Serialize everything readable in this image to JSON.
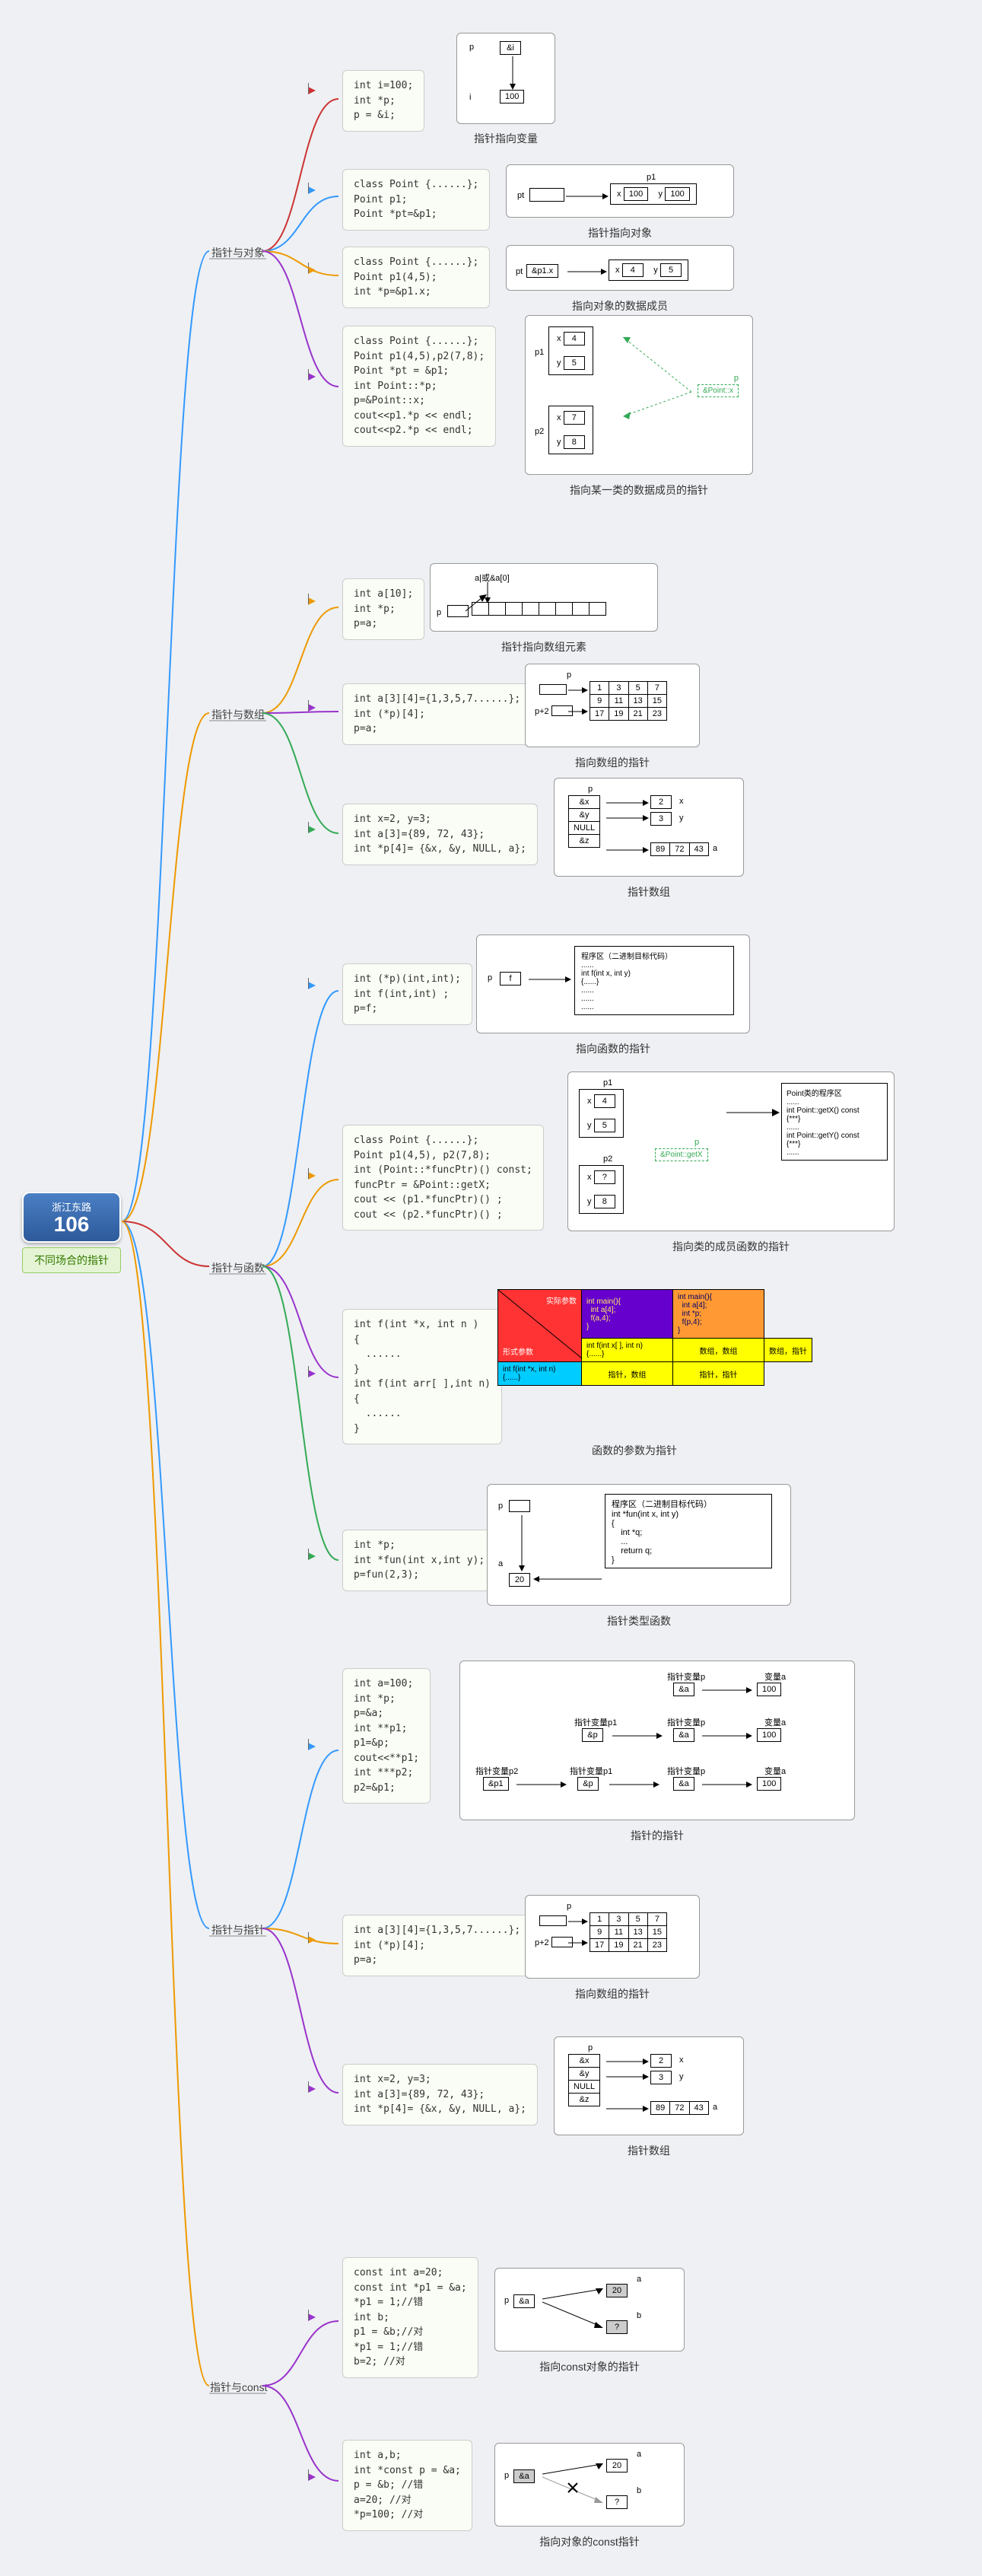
{
  "root": {
    "road": "浙江东路",
    "number": "106",
    "label": "不同场合的指针"
  },
  "branches": [
    {
      "id": "b1",
      "label": "指针与对象"
    },
    {
      "id": "b2",
      "label": "指针与数组"
    },
    {
      "id": "b3",
      "label": "指针与函数"
    },
    {
      "id": "b4",
      "label": "指针与指针"
    },
    {
      "id": "b5",
      "label": "指针与const"
    }
  ],
  "b1": {
    "n1": {
      "code": "int i=100;\nint *p;\np = &i;",
      "caption": "指针指向变量",
      "val_p": "&i",
      "val_i": "100",
      "lp": "p",
      "li": "i"
    },
    "n2": {
      "code": "class Point {......};\nPoint p1;\nPoint *pt=&p1;",
      "caption": "指针指向对象",
      "lbl_pt": "pt",
      "lbl_p1": "p1",
      "lbl_x": "x",
      "lbl_y": "y",
      "val_x": "100",
      "val_y": "100"
    },
    "n3": {
      "code": "class Point {......};\nPoint p1(4,5);\nint *p=&p1.x;",
      "caption": "指向对象的数据成员",
      "lbl_pt": "pt",
      "lbl_addr": "&p1.x",
      "lbl_x": "x",
      "lbl_y": "y",
      "val_x": "4",
      "val_y": "5"
    },
    "n4": {
      "code": "class Point {......};\nPoint p1(4,5),p2(7,8);\nPoint *pt = &p1;\nint Point::*p;\np=&Point::x;\ncout<<p1.*p << endl;\ncout<<p2.*p << endl;",
      "caption": "指向某一类的数据成员的指针",
      "lbl_p1": "p1",
      "lbl_p2": "p2",
      "lbl_x": "x",
      "lbl_y": "y",
      "vals": [
        "4",
        "5",
        "7",
        "8"
      ],
      "lbl_p": "p",
      "lbl_pointx": "&Point::x"
    }
  },
  "b2": {
    "n1": {
      "code": "int a[10];\nint *p;\np=a;",
      "caption": "指针指向数组元素",
      "lbl_a": "a|或&a[0]",
      "lbl_p": "p"
    },
    "n2": {
      "code": "int a[3][4]={1,3,5,7......};\nint (*p)[4];\np=a;",
      "caption": "指向数组的指针",
      "lbl_p": "p",
      "lbl_p2": "p+2",
      "row1": [
        "1",
        "3",
        "5",
        "7"
      ],
      "row2": [
        "9",
        "11",
        "13",
        "15"
      ],
      "row3": [
        "17",
        "19",
        "21",
        "23"
      ]
    },
    "n3": {
      "code": "int x=2, y=3;\nint a[3]={89, 72, 43};\nint *p[4]= {&x, &y, NULL, a};",
      "caption": "指针数组",
      "lbl_p": "p",
      "cells": [
        "&x",
        "&y",
        "NULL",
        "&z"
      ],
      "vals": [
        "2",
        "3"
      ],
      "lbl_x": "x",
      "lbl_y": "y",
      "lbl_a": "a",
      "arr": [
        "89",
        "72",
        "43"
      ]
    }
  },
  "b3": {
    "n1": {
      "code": "int (*p)(int,int);\nint f(int,int) ;\np=f;",
      "caption": "指向函数的指针",
      "lbl_p": "p",
      "lbl_f": "f",
      "box_hdr": "程序区（二进制目标代码）",
      "box_fn": "int f(int x, int y)\n{......}"
    },
    "n2": {
      "code": "class Point {......};\nPoint p1(4,5), p2(7,8);\nint (Point::*funcPtr)() const;\nfuncPtr = &Point::getX;\ncout << (p1.*funcPtr)() ;\ncout << (p2.*funcPtr)() ;",
      "caption": "指向类的成员函数的指针",
      "lbl_p1": "p1",
      "lbl_p2": "p2",
      "lbl_x": "x",
      "lbl_y": "y",
      "v1": [
        "4",
        "5"
      ],
      "v2": [
        "?",
        "8"
      ],
      "lbl_p": "p",
      "lbl_pg": "&Point::getX",
      "box_hdr": "Point类的程序区",
      "fn1": "int Point::getX() const\n{***}",
      "fn2": "int Point::getY() const\n{***}"
    },
    "n3": {
      "code": "int f(int *x, int n )\n{\n  ......\n}\nint f(int arr[ ],int n)\n{\n  ......\n}",
      "caption": "函数的参数为指针",
      "hdr_l": "实际参数",
      "hdr_tl": "int main(){",
      "hdr_tl2": "int a[4];",
      "hdr_tl3": "f(a,4);",
      "hdr_tr": "int a[4];",
      "hdr_tr2": "int *p;",
      "hdr_tr3": "f(p,4);",
      "hdr_m": "形式参数",
      "c1": "int f(int x[ ], int n)",
      "c2": "int f(int *x, int n)",
      "r1": "数组，数组",
      "r2": "数组，指针",
      "r3": "指针，数组",
      "r4": "指针，指针"
    },
    "n4": {
      "code": "int *p;\nint *fun(int x,int y);\np=fun(2,3);",
      "caption": "指针类型函数",
      "lbl_p": "p",
      "lbl_a": "a",
      "val": "20",
      "box_hdr": "程序区（二进制目标代码）",
      "box_fn": "int *fun(int x, int y)\n{\n    int *q;\n    ...\n    return q;\n}"
    }
  },
  "b4": {
    "n1": {
      "code": "int a=100;\nint *p;\np=&a;\nint **p1;\np1=&p;\ncout<<**p1;\nint ***p2;\np2=&p1;",
      "caption": "指针的指针",
      "row1_l": "指针变量p",
      "row1_v": "&a",
      "row1_r": "变量a",
      "row1_rv": "100",
      "row2_l": "指针变量p1",
      "row2_v": "&p",
      "row2_m": "指针变量p",
      "row2_mv": "&a",
      "row2_r": "变量a",
      "row2_rv": "100",
      "row3_l": "指针变量p2",
      "row3_v": "&p1",
      "row3_m1": "指针变量p1",
      "row3_m1v": "&p",
      "row3_m2": "指针变量p",
      "row3_m2v": "&a",
      "row3_r": "变量a",
      "row3_rv": "100"
    },
    "n2": {
      "code": "int a[3][4]={1,3,5,7......};\nint (*p)[4];\np=a;",
      "caption": "指向数组的指针",
      "lbl_p": "p",
      "lbl_p2": "p+2",
      "row1": [
        "1",
        "3",
        "5",
        "7"
      ],
      "row2": [
        "9",
        "11",
        "13",
        "15"
      ],
      "row3": [
        "17",
        "19",
        "21",
        "23"
      ]
    },
    "n3": {
      "code": "int x=2, y=3;\nint a[3]={89, 72, 43};\nint *p[4]= {&x, &y, NULL, a};",
      "caption": "指针数组",
      "lbl_p": "p",
      "cells": [
        "&x",
        "&y",
        "NULL",
        "&z"
      ],
      "vals": [
        "2",
        "3"
      ],
      "lbl_x": "x",
      "lbl_y": "y",
      "lbl_a": "a",
      "arr": [
        "89",
        "72",
        "43"
      ]
    }
  },
  "b5": {
    "n1": {
      "code": "const int a=20;\nconst int *p1 = &a;\n*p1 = 1;//错\nint b;\np1 = &b;//对\n*p1 = 1;//错\nb=2; //对",
      "caption": "指向const对象的指针",
      "lbl_p": "p",
      "lbl_addr": "&a",
      "lbl_a": "a",
      "lbl_b": "b",
      "val_a": "20",
      "val_b": "?"
    },
    "n2": {
      "code": "int a,b;\nint *const p = &a;\np = &b; //错\na=20; //对\n*p=100; //对",
      "caption": "指向对象的const指针",
      "lbl_p": "p",
      "lbl_addr": "&a",
      "lbl_a": "a",
      "lbl_b": "b",
      "val_a": "20",
      "val_b": "?"
    }
  }
}
